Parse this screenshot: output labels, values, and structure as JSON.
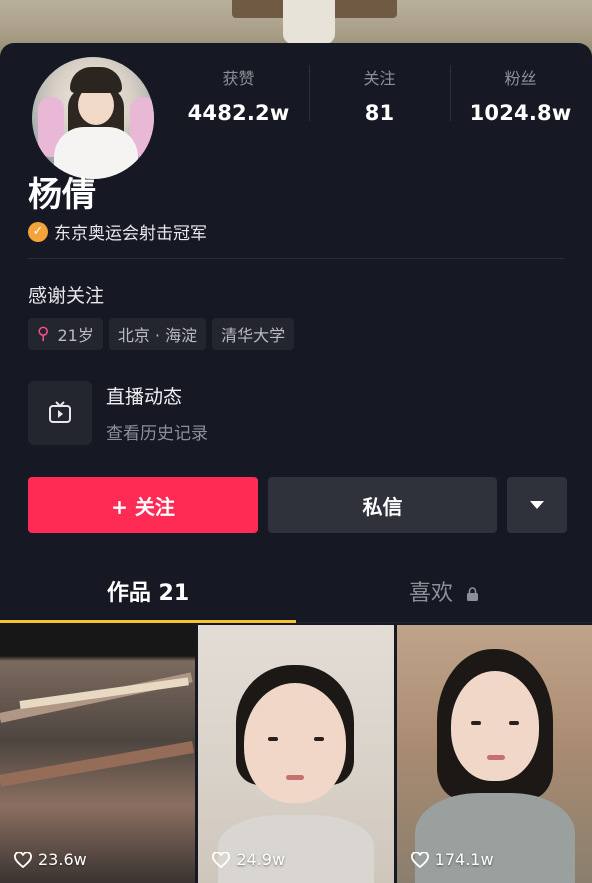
{
  "stats": [
    {
      "label": "获赞",
      "value": "4482.2w"
    },
    {
      "label": "关注",
      "value": "81"
    },
    {
      "label": "粉丝",
      "value": "1024.8w"
    }
  ],
  "profile": {
    "name": "杨倩",
    "verified_text": "东京奥运会射击冠军",
    "bio": "感谢关注",
    "tags": {
      "age": "21岁",
      "location": "北京 · 海淀",
      "school": "清华大学"
    }
  },
  "live": {
    "title": "直播动态",
    "subtitle": "查看历史记录"
  },
  "actions": {
    "follow": "+ 关注",
    "message": "私信"
  },
  "tabs": {
    "works": "作品 21",
    "likes": "喜欢"
  },
  "videos": [
    {
      "likes": "23.6w"
    },
    {
      "likes": "24.9w"
    },
    {
      "likes": "174.1w"
    }
  ],
  "colors": {
    "accent": "#fe2c55",
    "tab_indicator": "#f2c433",
    "verified": "#f2a33a",
    "female": "#ff4f8a"
  }
}
